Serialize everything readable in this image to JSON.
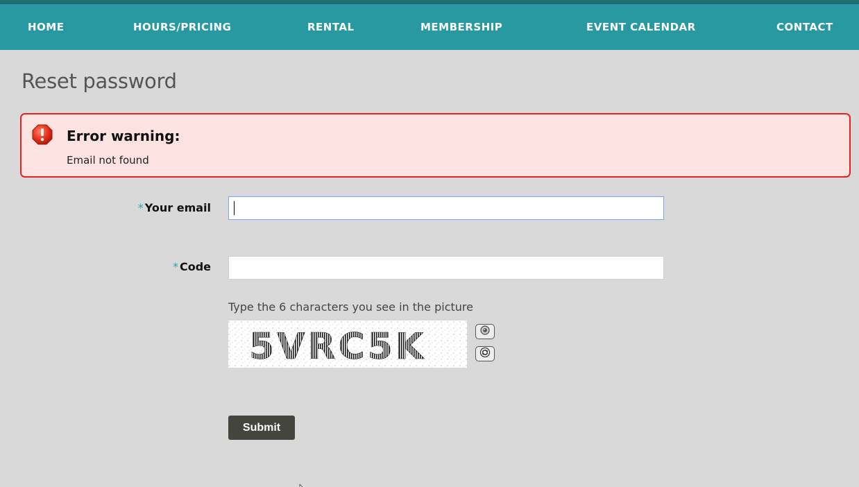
{
  "nav": {
    "items": [
      {
        "label": "HOME"
      },
      {
        "label": "HOURS/PRICING"
      },
      {
        "label": "RENTAL"
      },
      {
        "label": "MEMBERSHIP"
      },
      {
        "label": "EVENT CALENDAR"
      },
      {
        "label": "CONTACT"
      }
    ]
  },
  "page": {
    "title": "Reset password"
  },
  "error": {
    "title": "Error warning:",
    "message": "Email not found",
    "icon": "error-octagon-icon"
  },
  "form": {
    "required_marker": "*",
    "email": {
      "label": "Your email",
      "value": "",
      "placeholder": ""
    },
    "code": {
      "label": "Code",
      "value": "",
      "placeholder": ""
    },
    "captcha": {
      "hint": "Type the 6 characters you see in the picture",
      "image_text": "5VRC5K",
      "audio_icon": "speaker-icon",
      "refresh_icon": "refresh-icon"
    },
    "submit_label": "Submit"
  },
  "colors": {
    "nav_bg": "#2899a0",
    "page_bg": "#d9d9d9",
    "error_bg": "#fde2e2",
    "error_border": "#e52222",
    "required_marker": "#2aa8a8",
    "submit_bg": "#44453f"
  }
}
